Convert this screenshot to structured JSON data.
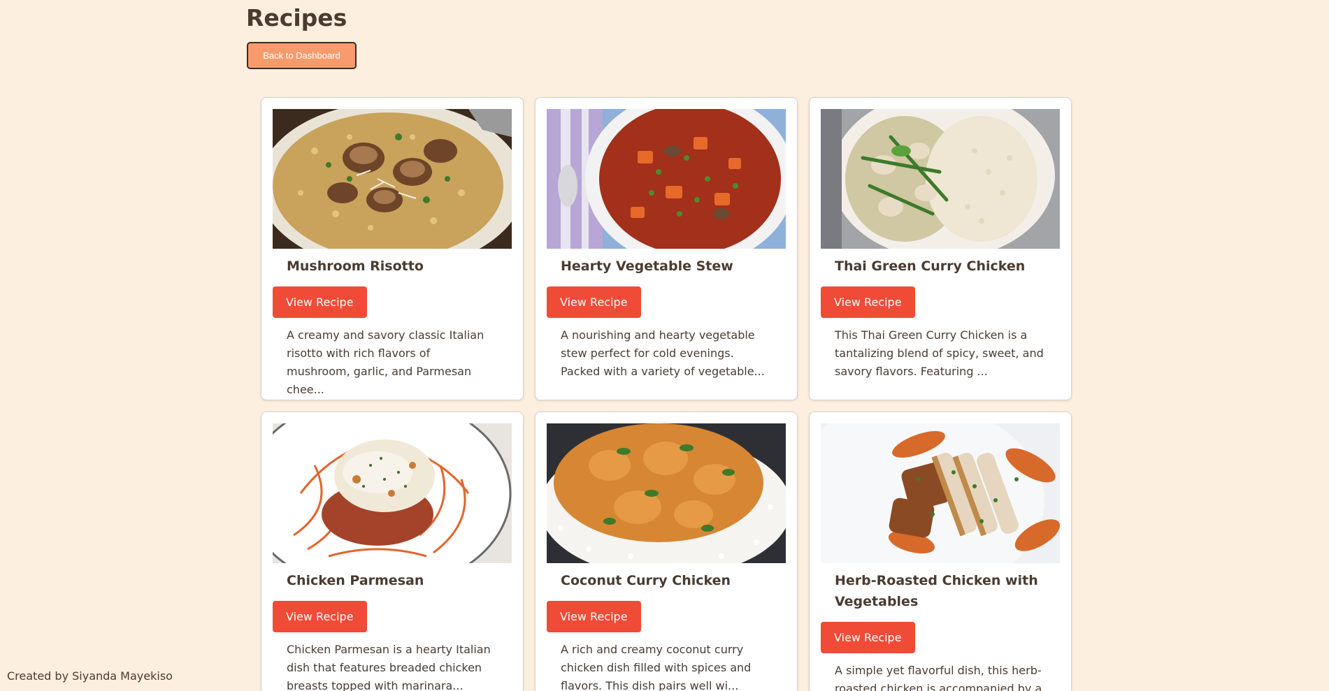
{
  "page": {
    "title": "Recipes",
    "back_button_label": "Back to Dashboard",
    "footer_credit": "Created by Siyanda Mayekiso"
  },
  "recipes": [
    {
      "title": "Mushroom Risotto",
      "button_label": "View Recipe",
      "description": "A creamy and savory classic Italian risotto with rich flavors of mushroom, garlic, and Parmesan chee..."
    },
    {
      "title": "Hearty Vegetable Stew",
      "button_label": "View Recipe",
      "description": "A nourishing and hearty vegetable stew perfect for cold evenings. Packed with a variety of vegetable..."
    },
    {
      "title": "Thai Green Curry Chicken",
      "button_label": "View Recipe",
      "description": "This Thai Green Curry Chicken is a tantalizing blend of spicy, sweet, and savory flavors. Featuring ..."
    },
    {
      "title": "Chicken Parmesan",
      "button_label": "View Recipe",
      "description": "Chicken Parmesan is a hearty Italian dish that features breaded chicken breasts topped with marinara..."
    },
    {
      "title": "Coconut Curry Chicken",
      "button_label": "View Recipe",
      "description": "A rich and creamy coconut curry chicken dish filled with spices and flavors. This dish pairs well wi..."
    },
    {
      "title": "Herb-Roasted Chicken with Vegetables",
      "button_label": "View Recipe",
      "description": "A simple yet flavorful dish, this herb-roasted chicken is accompanied by a"
    }
  ],
  "colors": {
    "background": "#fdefe0",
    "accent_button": "#ef4b36",
    "back_button": "#f79a6c",
    "text": "#4a3b31"
  }
}
